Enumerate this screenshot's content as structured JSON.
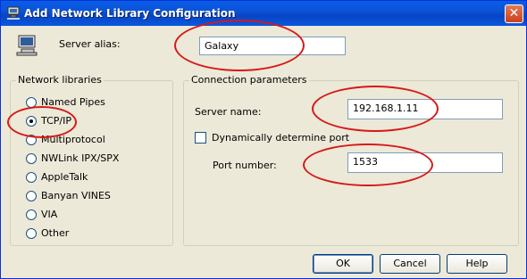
{
  "window": {
    "title": "Add Network Library Configuration",
    "close_glyph": "✕"
  },
  "server_alias": {
    "label": "Server alias:",
    "value": "Galaxy"
  },
  "network_libraries": {
    "group_label": "Network libraries",
    "options": [
      {
        "label": "Named Pipes",
        "checked": false
      },
      {
        "label": "TCP/IP",
        "checked": true
      },
      {
        "label": "Multiprotocol",
        "checked": false
      },
      {
        "label": "NWLink IPX/SPX",
        "checked": false
      },
      {
        "label": "AppleTalk",
        "checked": false
      },
      {
        "label": "Banyan VINES",
        "checked": false
      },
      {
        "label": "VIA",
        "checked": false
      },
      {
        "label": "Other",
        "checked": false
      }
    ]
  },
  "connection_parameters": {
    "group_label": "Connection parameters",
    "server_name_label": "Server name:",
    "server_name_value": "192.168.1.11",
    "dynamic_port_label": "Dynamically determine port",
    "dynamic_port_checked": false,
    "port_number_label": "Port number:",
    "port_number_value": "1533"
  },
  "buttons": {
    "ok": "OK",
    "cancel": "Cancel",
    "help": "Help"
  },
  "icons": {
    "title_icon": "network-computer-icon",
    "alias_icon": "computer-icon"
  },
  "colors": {
    "titlebar": "#0a5ee6",
    "annotation": "#d81818"
  }
}
